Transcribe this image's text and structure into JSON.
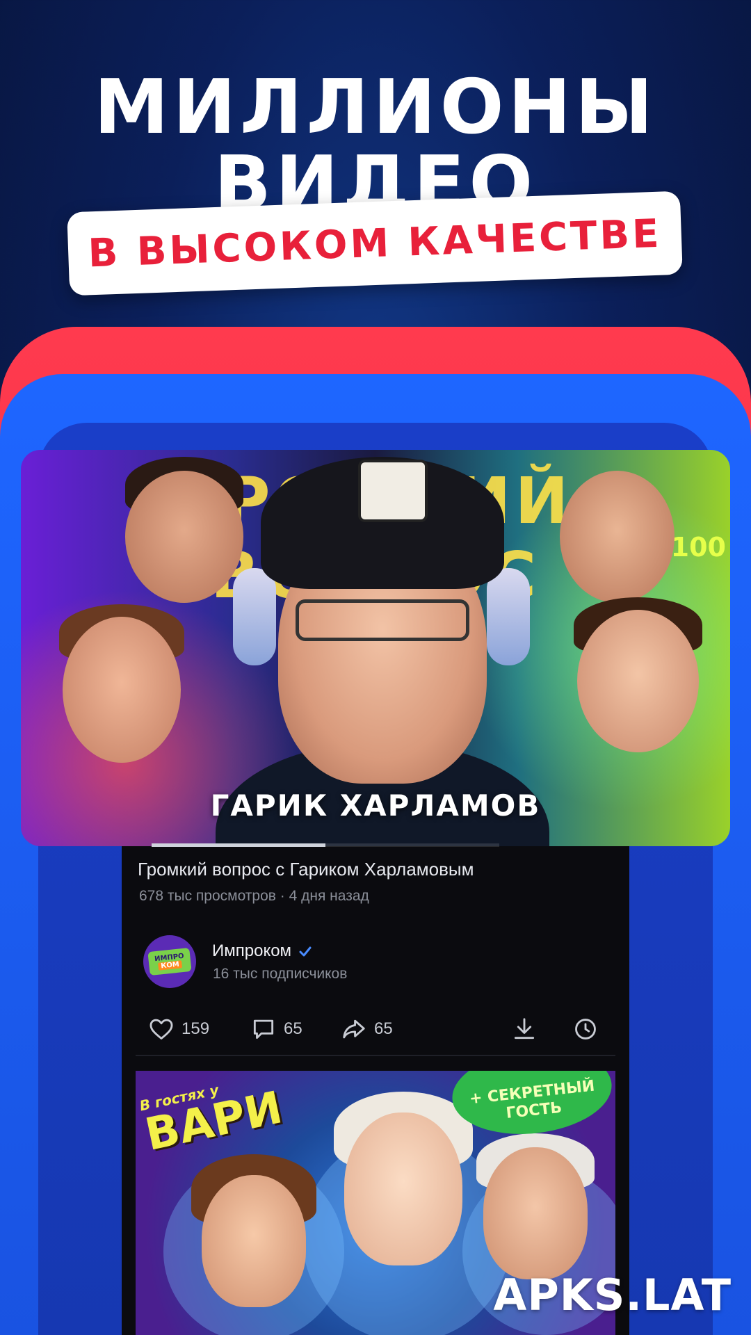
{
  "promo": {
    "headline_line1": "МИЛЛИОНЫ",
    "headline_line2": "ВИДЕО",
    "subheadline": "В ВЫСОКОМ КАЧЕСТВЕ",
    "accent_red": "#e8203a",
    "accent_blue": "#1e66ff"
  },
  "featured_video": {
    "thumbnail": {
      "title_text": "ГРОМКИЙ ВОПРОС",
      "price_text": "₽100",
      "caption": "ГАРИК ХАРЛАМОВ"
    },
    "playback_progress": 0.5,
    "title": "Громкий вопрос с Гариком Харламовым",
    "meta": "678 тыс просмотров · 4 дня назад",
    "channel": {
      "logo_top": "ИМПРО",
      "logo_bottom": "КОМ",
      "name": "Импроком",
      "verified": true,
      "subscribers": "16 тыс подписчиков"
    },
    "actions": {
      "likes": "159",
      "comments": "65",
      "shares": "65",
      "icons": [
        "heart-icon",
        "comment-icon",
        "share-icon",
        "download-icon",
        "clock-icon"
      ]
    }
  },
  "next_video": {
    "thumbnail": {
      "sticker_small": "В гостях у",
      "sticker_big": "ВАРИ",
      "badge": "+ СЕКРЕТНЫЙ ГОСТЬ"
    }
  },
  "watermark": "APKS.LAT"
}
